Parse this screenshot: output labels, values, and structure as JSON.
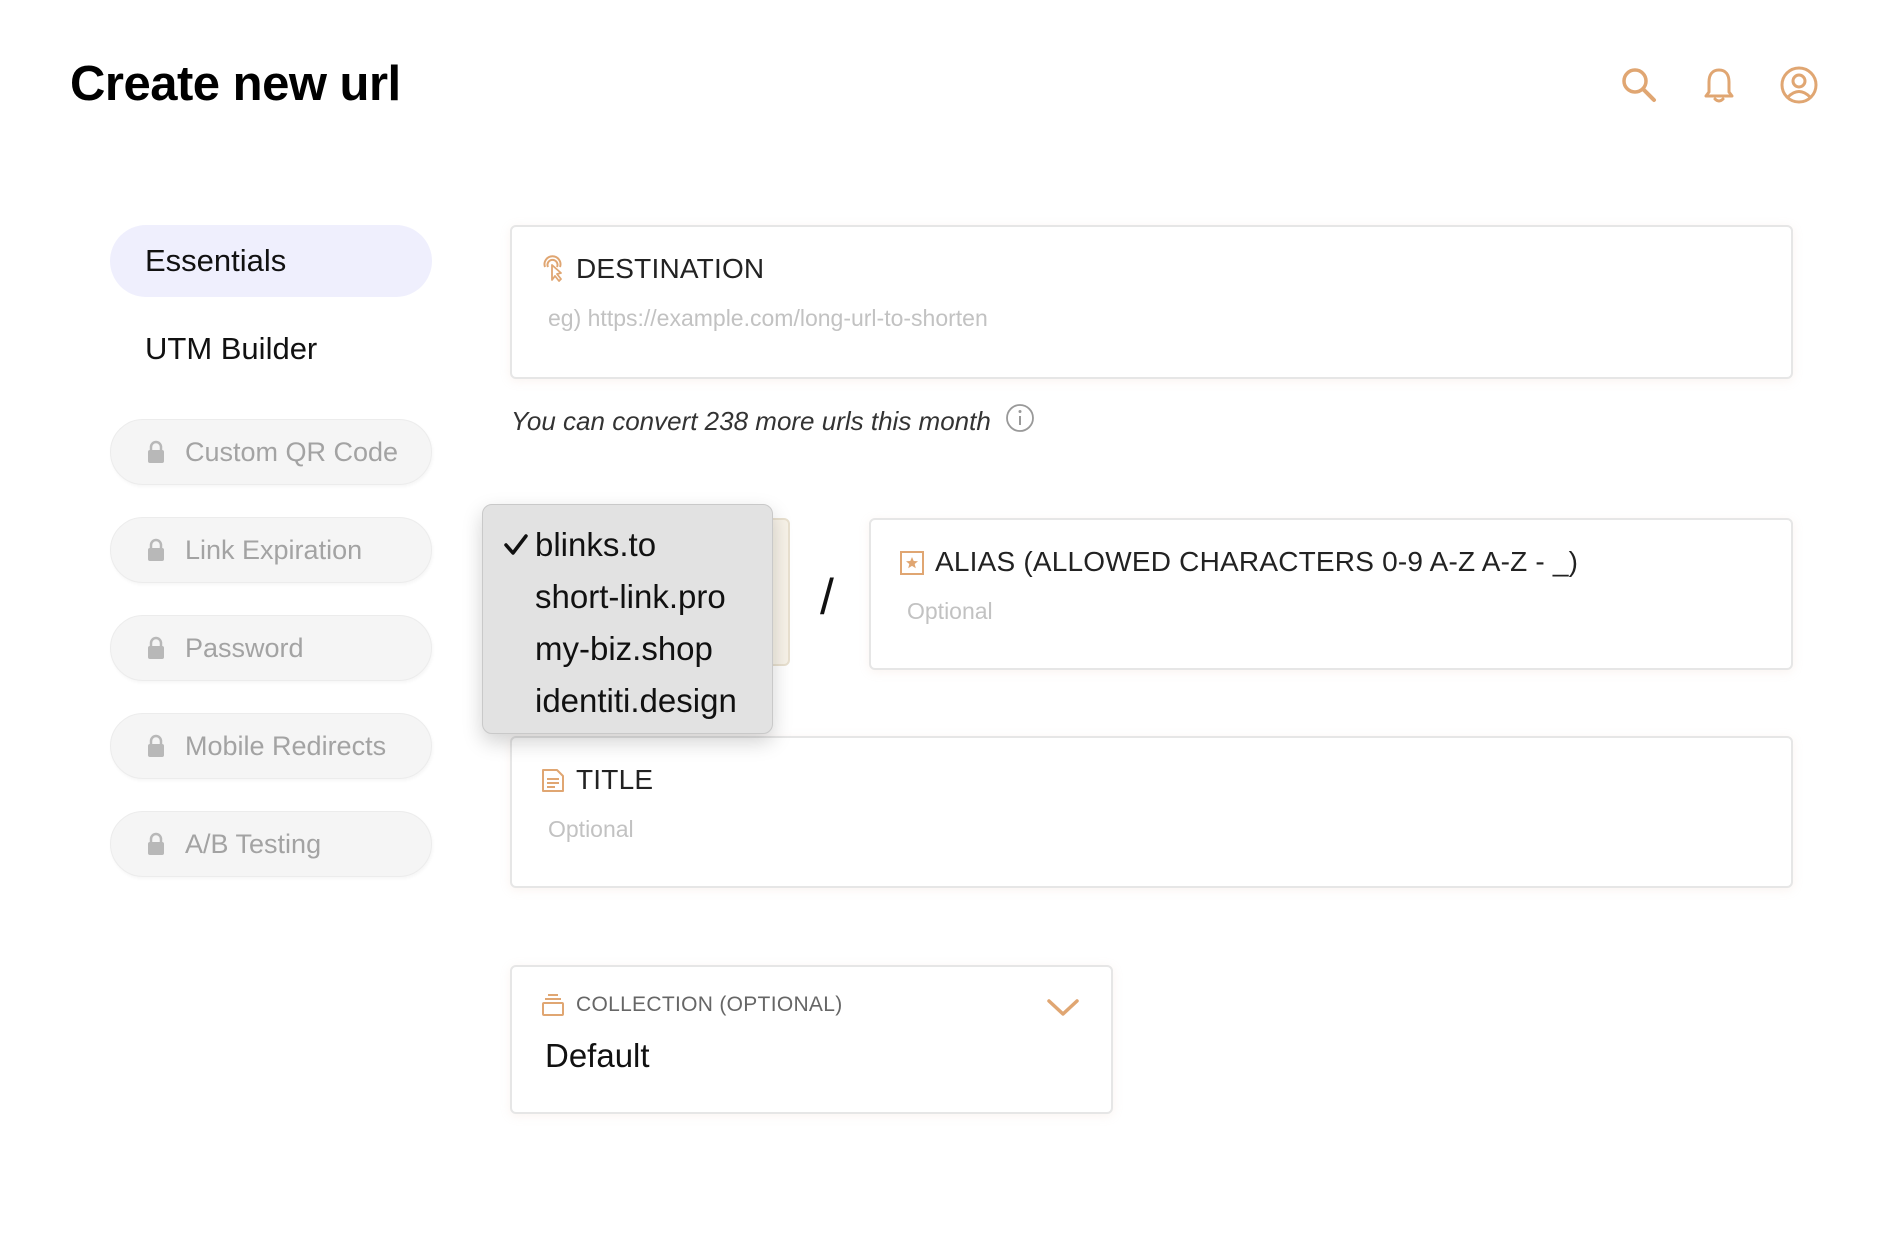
{
  "header": {
    "title": "Create new url",
    "icons": [
      "search-icon",
      "bell-icon",
      "user-circle-icon"
    ],
    "accent_color": "#e0a672"
  },
  "sidebar": {
    "nav": [
      {
        "label": "Essentials",
        "active": true
      },
      {
        "label": "UTM Builder",
        "active": false
      }
    ],
    "locked": [
      {
        "label": "Custom QR Code",
        "icon": "lock-icon"
      },
      {
        "label": "Link Expiration",
        "icon": "lock-icon"
      },
      {
        "label": "Password",
        "icon": "lock-icon"
      },
      {
        "label": "Mobile Redirects",
        "icon": "lock-icon"
      },
      {
        "label": "A/B Testing",
        "icon": "lock-icon"
      }
    ]
  },
  "destination": {
    "label": "DESTINATION",
    "icon": "pointer-click-icon",
    "value": "",
    "placeholder": "eg) https://example.com/long-url-to-shorten"
  },
  "quota": {
    "text": "You can convert 238 more urls this month",
    "icon": "info-icon"
  },
  "domain": {
    "selected": "blinks.to",
    "options": [
      "blinks.to",
      "short-link.pro",
      "my-biz.shop",
      "identiti.design"
    ],
    "separator": "/"
  },
  "alias": {
    "label": "ALIAS (ALLOWED CHARACTERS 0-9 A-Z A-Z - _)",
    "icon": "star-box-icon",
    "value": "",
    "placeholder": "Optional"
  },
  "title_field": {
    "label": "TITLE",
    "icon": "document-icon",
    "value": "",
    "placeholder": "Optional"
  },
  "collection": {
    "label": "COLLECTION (OPTIONAL)",
    "icon": "stack-icon",
    "value": "Default"
  }
}
